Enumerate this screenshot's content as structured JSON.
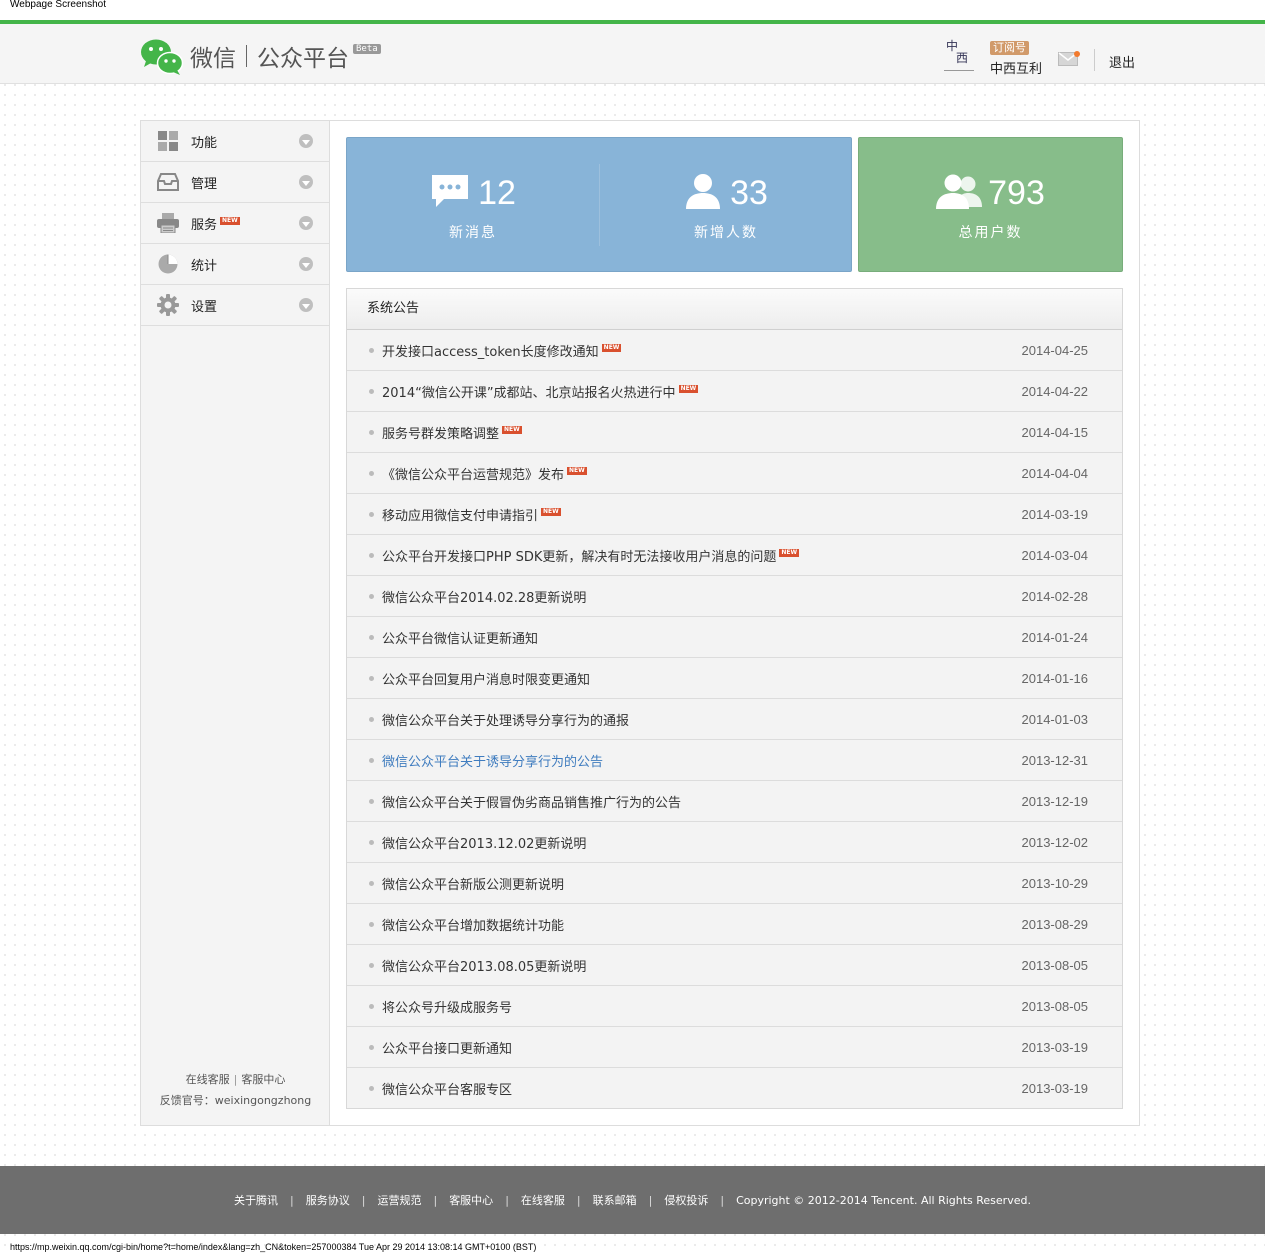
{
  "screenshot": {
    "caption": "Webpage Screenshot",
    "footer_url": "https://mp.weixin.qq.com/cgi-bin/home?t=home/index&lang=zh_CN&token=257000384 Tue Apr 29 2014 13:08:14 GMT+0100 (BST)"
  },
  "header": {
    "brand": "微信",
    "product": "公众平台",
    "beta": "Beta",
    "account_type": "订阅号",
    "account_name": "中西互利",
    "logout": "退出",
    "avatar_text_1": "中",
    "avatar_text_2": "西"
  },
  "colors": {
    "accent": "#44b549",
    "stat_blue": "#88b4d8",
    "stat_green": "#87bd8a",
    "new_badge": "#d9502e",
    "link": "#3f7cbf"
  },
  "sidebar": {
    "items": [
      {
        "label": "功能",
        "icon": "grid-icon",
        "new": false
      },
      {
        "label": "管理",
        "icon": "inbox-icon",
        "new": false
      },
      {
        "label": "服务",
        "icon": "printer-icon",
        "new": true
      },
      {
        "label": "统计",
        "icon": "pie-chart-icon",
        "new": false
      },
      {
        "label": "设置",
        "icon": "gear-icon",
        "new": false
      }
    ],
    "new_label": "NEW",
    "footer_service": "在线客服",
    "footer_center": "客服中心",
    "footer_feedback": "反馈官号：weixingongzhong"
  },
  "stats": {
    "messages": {
      "value": "12",
      "label": "新消息"
    },
    "new_users": {
      "value": "33",
      "label": "新增人数"
    },
    "total_users": {
      "value": "793",
      "label": "总用户数"
    }
  },
  "notice": {
    "title": "系统公告",
    "items": [
      {
        "title": "开发接口access_token长度修改通知",
        "date": "2014-04-25",
        "new": true
      },
      {
        "title": "2014“微信公开课”成都站、北京站报名火热进行中",
        "date": "2014-04-22",
        "new": true
      },
      {
        "title": "服务号群发策略调整",
        "date": "2014-04-15",
        "new": true
      },
      {
        "title": "《微信公众平台运营规范》发布",
        "date": "2014-04-04",
        "new": true
      },
      {
        "title": "移动应用微信支付申请指引",
        "date": "2014-03-19",
        "new": true
      },
      {
        "title": "公众平台开发接口PHP SDK更新，解决有时无法接收用户消息的问题",
        "date": "2014-03-04",
        "new": true
      },
      {
        "title": "微信公众平台2014.02.28更新说明",
        "date": "2014-02-28",
        "new": false
      },
      {
        "title": "公众平台微信认证更新通知",
        "date": "2014-01-24",
        "new": false
      },
      {
        "title": "公众平台回复用户消息时限变更通知",
        "date": "2014-01-16",
        "new": false
      },
      {
        "title": "微信公众平台关于处理诱导分享行为的通报",
        "date": "2014-01-03",
        "new": false
      },
      {
        "title": "微信公众平台关于诱导分享行为的公告",
        "date": "2013-12-31",
        "new": false
      },
      {
        "title": "微信公众平台关于假冒伪劣商品销售推广行为的公告",
        "date": "2013-12-19",
        "new": false
      },
      {
        "title": "微信公众平台2013.12.02更新说明",
        "date": "2013-12-02",
        "new": false
      },
      {
        "title": "微信公众平台新版公测更新说明",
        "date": "2013-10-29",
        "new": false
      },
      {
        "title": "微信公众平台增加数据统计功能",
        "date": "2013-08-29",
        "new": false
      },
      {
        "title": "微信公众平台2013.08.05更新说明",
        "date": "2013-08-05",
        "new": false
      },
      {
        "title": "将公众号升级成服务号",
        "date": "2013-08-05",
        "new": false
      },
      {
        "title": "公众平台接口更新通知",
        "date": "2013-03-19",
        "new": false
      },
      {
        "title": "微信公众平台客服专区",
        "date": "2013-03-19",
        "new": false
      }
    ]
  },
  "footer": {
    "links": [
      "关于腾讯",
      "服务协议",
      "运营规范",
      "客服中心",
      "在线客服",
      "联系邮箱",
      "侵权投诉"
    ],
    "copyright": "Copyright © 2012-2014 Tencent. All Rights Reserved."
  }
}
